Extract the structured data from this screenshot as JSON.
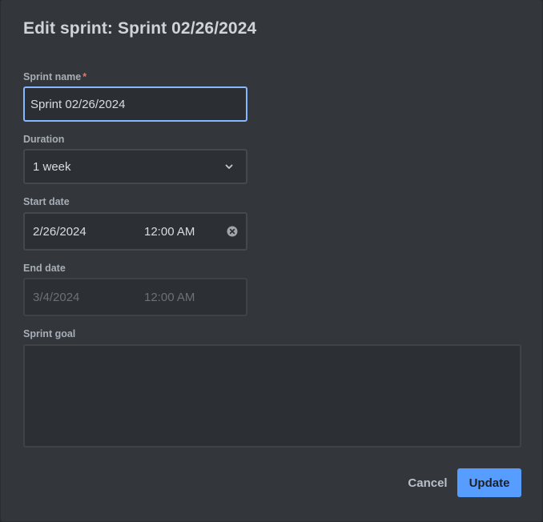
{
  "dialog": {
    "title": "Edit sprint: Sprint 02/26/2024"
  },
  "form": {
    "sprint_name": {
      "label": "Sprint name",
      "required_marker": "*",
      "value": "Sprint 02/26/2024"
    },
    "duration": {
      "label": "Duration",
      "selected": "1 week",
      "icon": "chevron-down-icon"
    },
    "start_date": {
      "label": "Start date",
      "date": "2/26/2024",
      "time": "12:00 AM",
      "icon": "clear-icon"
    },
    "end_date": {
      "label": "End date",
      "date": "3/4/2024",
      "time": "12:00 AM"
    },
    "sprint_goal": {
      "label": "Sprint goal",
      "value": ""
    }
  },
  "actions": {
    "cancel_label": "Cancel",
    "update_label": "Update"
  },
  "colors": {
    "dialog_background": "#33373b",
    "focus_border": "#85b8ff",
    "primary_button": "#579dff",
    "required_marker": "#e2776e"
  }
}
